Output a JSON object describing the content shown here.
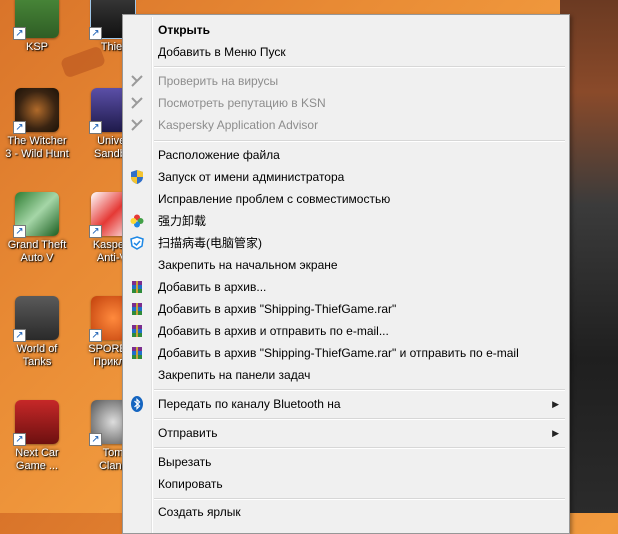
{
  "desktop": {
    "icons": [
      {
        "label": "KSP",
        "name": "desktop-icon-ksp"
      },
      {
        "label": "Thief",
        "name": "desktop-icon-thief"
      },
      {
        "label": "The Witcher\n3 - Wild Hunt",
        "name": "desktop-icon-witcher"
      },
      {
        "label": "Univer\nSandbo",
        "name": "desktop-icon-universe-sandbox"
      },
      {
        "label": "Grand Theft\nAuto V",
        "name": "desktop-icon-gta5"
      },
      {
        "label": "Kaspers\nAnti-Vi",
        "name": "desktop-icon-kaspersky"
      },
      {
        "label": "World of\nTanks",
        "name": "desktop-icon-wot"
      },
      {
        "label": "SPORE-K\nПриклю",
        "name": "desktop-icon-spore"
      },
      {
        "label": "Next Car\nGame ...",
        "name": "desktop-icon-next-car-game"
      },
      {
        "label": "Tom\nClanc",
        "name": "desktop-icon-tom-clancy"
      }
    ],
    "shortcut_glyph": "↗"
  },
  "menu": {
    "items": [
      {
        "label": "Открыть"
      },
      {
        "label": "Добавить в Меню Пуск"
      },
      {
        "label": "Проверить на вирусы"
      },
      {
        "label": "Посмотреть репутацию в KSN"
      },
      {
        "label": "Kaspersky Application Advisor"
      },
      {
        "label": "Расположение файла"
      },
      {
        "label": "Запуск от имени администратора"
      },
      {
        "label": "Исправление проблем с совместимостью"
      },
      {
        "label": "强力卸载"
      },
      {
        "label": "扫描病毒(电脑管家)"
      },
      {
        "label": "Закрепить на начальном экране"
      },
      {
        "label": "Добавить в архив..."
      },
      {
        "label": "Добавить в архив \"Shipping-ThiefGame.rar\""
      },
      {
        "label": "Добавить в архив и отправить по e-mail..."
      },
      {
        "label": "Добавить в архив \"Shipping-ThiefGame.rar\" и отправить по e-mail"
      },
      {
        "label": "Закрепить на панели задач"
      },
      {
        "label": "Передать по каналу Bluetooth на"
      },
      {
        "label": "Отправить"
      },
      {
        "label": "Вырезать"
      },
      {
        "label": "Копировать"
      },
      {
        "label": "Создать ярлык"
      }
    ],
    "submenu_arrow": "▶"
  },
  "colors": {
    "menu_bg": "#f0f0f0",
    "disabled_text": "#8d8d8d",
    "bluetooth": "#1565c0",
    "winrar": "#7b2d8e"
  }
}
